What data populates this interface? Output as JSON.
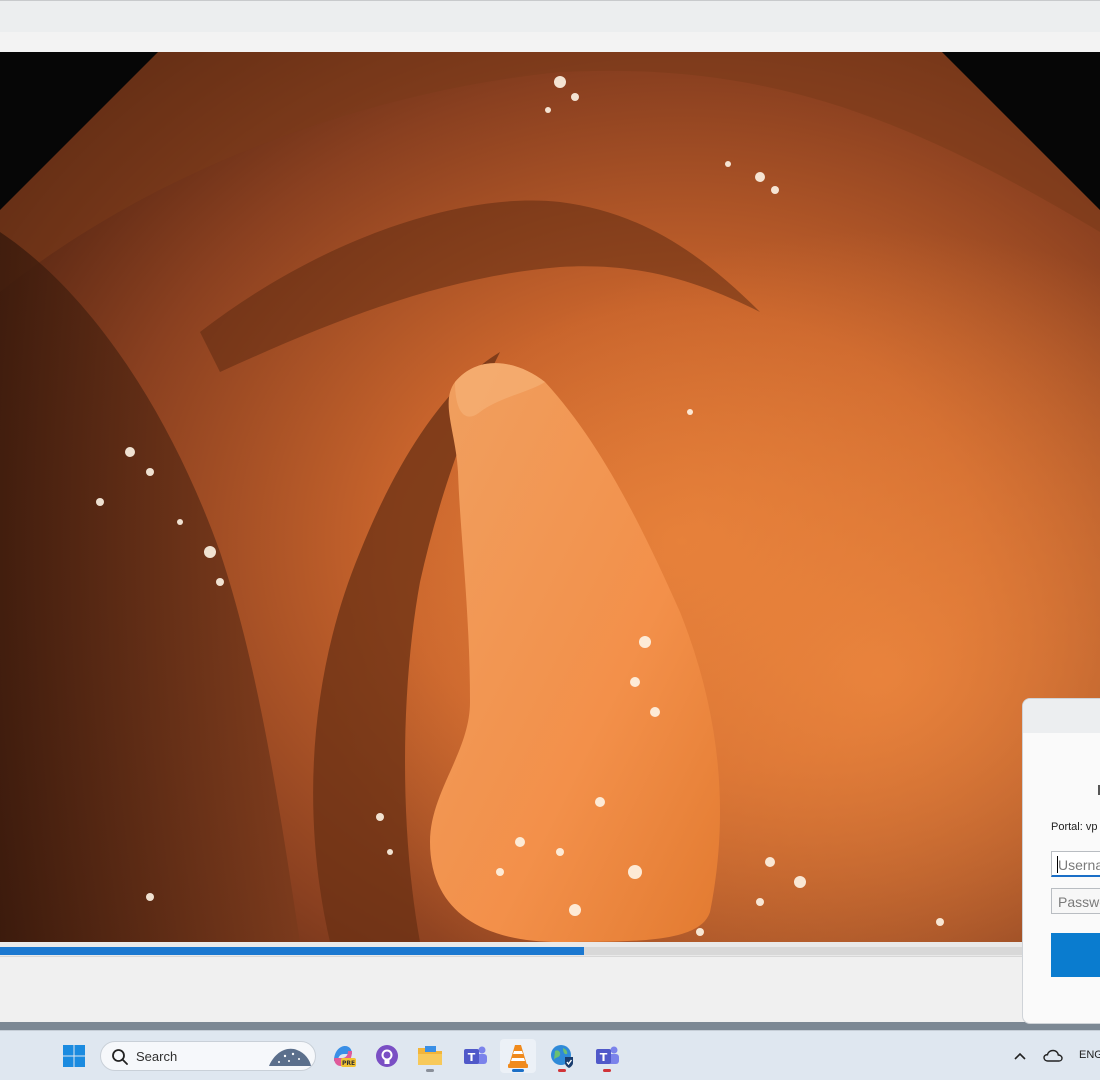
{
  "player": {
    "playback_progress_percent": 56.7
  },
  "taskbar": {
    "start_icon": "windows-start-icon",
    "search_placeholder": "Search",
    "pinned_apps": [
      {
        "name": "copilot-preview-icon",
        "badge": "PRE"
      },
      {
        "name": "github-icon"
      },
      {
        "name": "file-explorer-icon"
      },
      {
        "name": "teams-icon"
      },
      {
        "name": "vlc-icon"
      },
      {
        "name": "vpn-globe-icon"
      },
      {
        "name": "teams-app-icon"
      }
    ],
    "tray": {
      "language": "ENG",
      "icons": [
        "chevron-up-icon",
        "onedrive-cloud-icon"
      ]
    },
    "colors": {
      "active_indicator": "#1b6fc7",
      "alert_indicator": "#d13438"
    }
  },
  "vpn_dialog": {
    "portal_label": "Portal: vp",
    "username_placeholder": "Userna",
    "password_placeholder": "Passwo",
    "connect_button_color": "#0a7ccf"
  }
}
